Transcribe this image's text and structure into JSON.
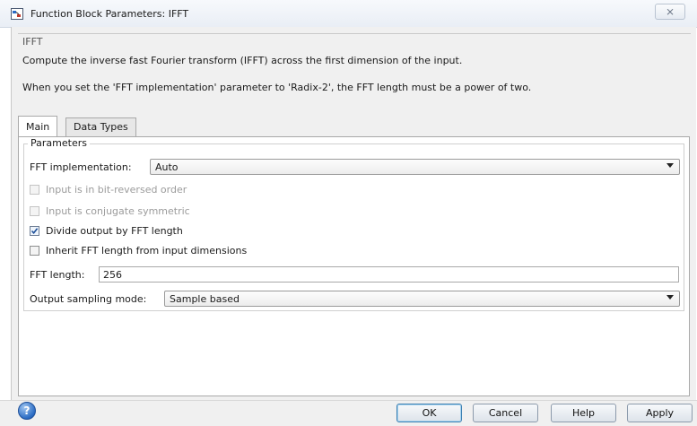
{
  "window": {
    "title": "Function Block Parameters: IFFT",
    "close_glyph": "⨯"
  },
  "description": {
    "block_name": "IFFT",
    "line1": "Compute the inverse fast Fourier transform (IFFT) across the first dimension of the input.",
    "line2": "When you set the 'FFT implementation' parameter to 'Radix-2', the FFT length must be a power of two."
  },
  "tabs": [
    {
      "label": "Main",
      "active": true
    },
    {
      "label": "Data Types",
      "active": false
    }
  ],
  "parameters": {
    "group_label": "Parameters",
    "fft_impl_label": "FFT implementation:",
    "fft_impl_value": "Auto",
    "checkboxes": [
      {
        "label": "Input is in bit-reversed order",
        "checked": false,
        "enabled": false
      },
      {
        "label": "Input is conjugate symmetric",
        "checked": false,
        "enabled": false
      },
      {
        "label": "Divide output by FFT length",
        "checked": true,
        "enabled": true
      },
      {
        "label": "Inherit FFT length from input dimensions",
        "checked": false,
        "enabled": true
      }
    ],
    "fft_length_label": "FFT length:",
    "fft_length_value": "256",
    "output_mode_label": "Output sampling mode:",
    "output_mode_value": "Sample based"
  },
  "buttons": {
    "help_glyph": "?",
    "ok": "OK",
    "cancel": "Cancel",
    "help": "Help",
    "apply": "Apply"
  },
  "icons": [
    "app-icon",
    "close-icon",
    "help-icon",
    "dropdown-arrow-icon",
    "checkmark-icon"
  ]
}
